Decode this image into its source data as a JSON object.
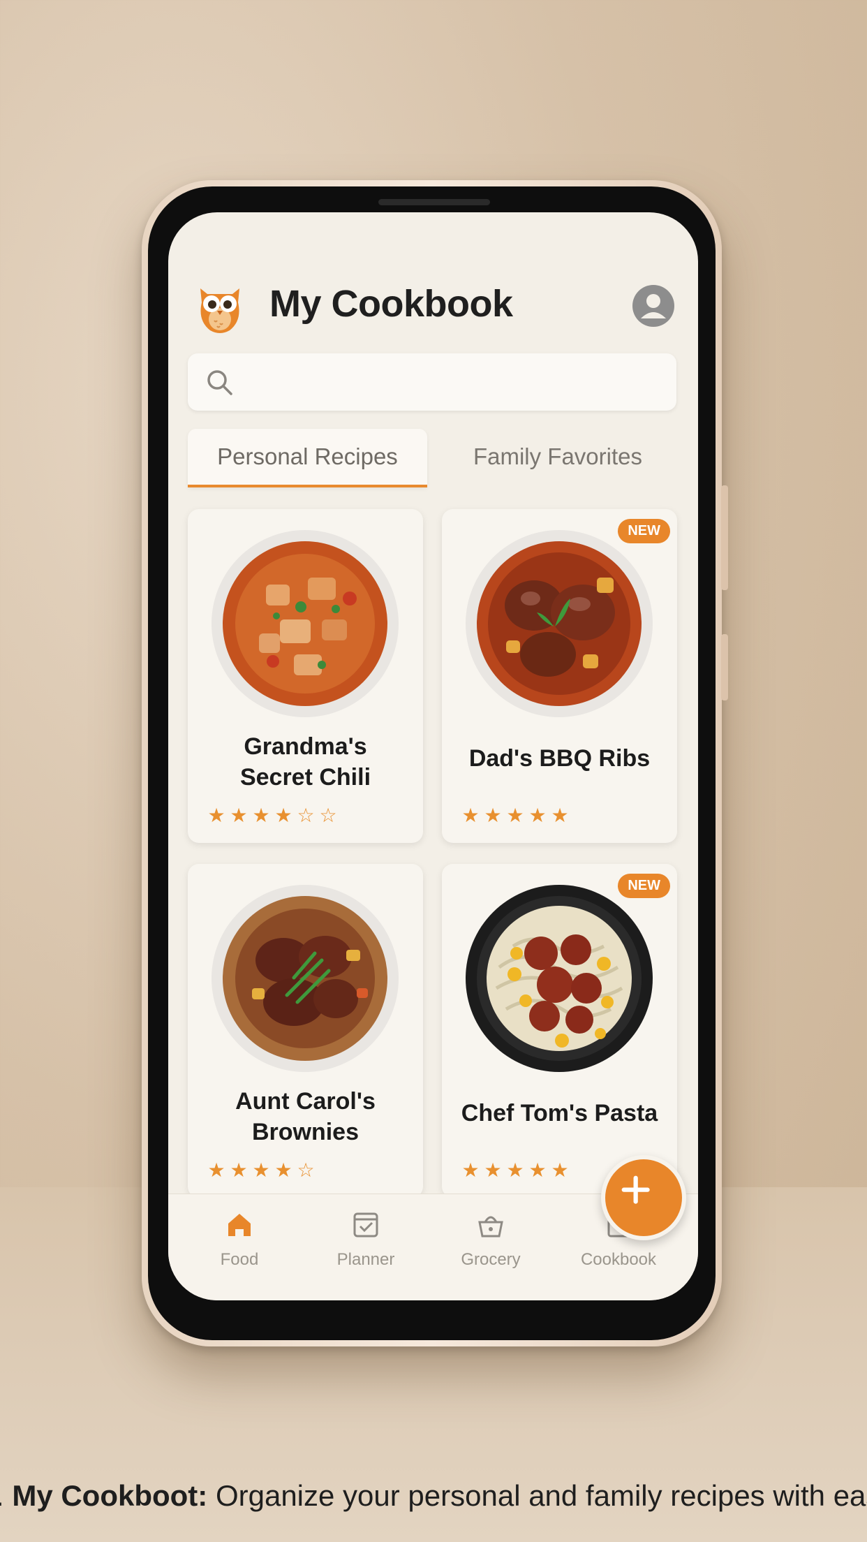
{
  "app": {
    "title": "My Cookbook"
  },
  "search": {
    "placeholder": "",
    "value": ""
  },
  "tabs": [
    {
      "label": "Personal Recipes",
      "active": true
    },
    {
      "label": "Family Favorites",
      "active": false
    }
  ],
  "recipes": [
    {
      "title_line1": "Grandma's",
      "title_line2": "Secret Chili",
      "rating": 3.5,
      "badge": ""
    },
    {
      "title_line1": "Dad's BBQ Ribs",
      "title_line2": "",
      "rating": 4.5,
      "badge": "NEW"
    },
    {
      "title_line1": "Aunt Carol's",
      "title_line2": "Brownies",
      "rating": 4.5,
      "badge": ""
    },
    {
      "title_line1": "Chef Tom's Pasta",
      "title_line2": "",
      "rating": 4.5,
      "badge": "NEW"
    }
  ],
  "bottom_nav": [
    {
      "label": "Food",
      "icon": "home-icon",
      "active": true
    },
    {
      "label": "Planner",
      "icon": "calendar-check-icon",
      "active": false
    },
    {
      "label": "Grocery",
      "icon": "basket-icon",
      "active": false
    },
    {
      "label": "Cookbook",
      "icon": "book-icon",
      "active": false
    }
  ],
  "fab": {
    "icon": "plus-icon"
  },
  "caption": {
    "prefix": "-. ",
    "bold": "My Cookboot:",
    "rest": " Organize your personal and family recipes with eas"
  },
  "colors": {
    "accent": "#e8862a",
    "background": "#f3efe7",
    "star": "#e8902f"
  }
}
